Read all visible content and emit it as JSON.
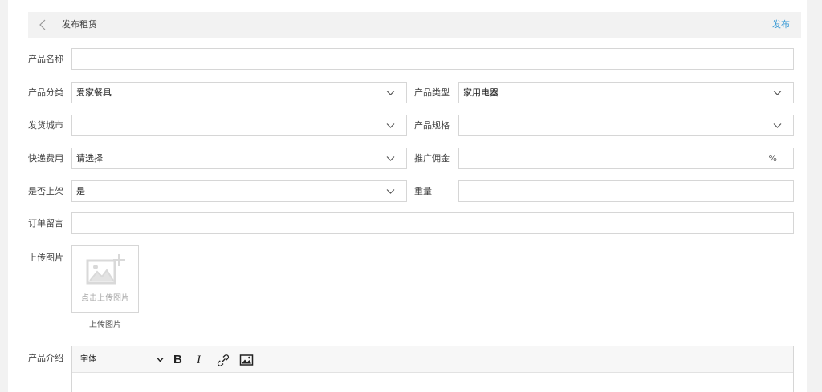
{
  "header": {
    "title": "发布租赁",
    "publish_label": "发布"
  },
  "form": {
    "product_name": {
      "label": "产品名称",
      "value": ""
    },
    "product_category": {
      "label": "产品分类",
      "value": "爱家餐具"
    },
    "product_type": {
      "label": "产品类型",
      "value": "家用电器"
    },
    "ship_city": {
      "label": "发货城市",
      "value": ""
    },
    "product_spec": {
      "label": "产品规格",
      "value": ""
    },
    "shipping_fee": {
      "label": "快递费用",
      "value": "请选择"
    },
    "promo_commission": {
      "label": "推广佣金",
      "value": "",
      "suffix": "%"
    },
    "on_shelf": {
      "label": "是否上架",
      "value": "是"
    },
    "weight": {
      "label": "重量",
      "value": ""
    },
    "order_note": {
      "label": "订单留言",
      "value": ""
    },
    "upload": {
      "label": "上传图片",
      "button_text": "点击上传图片",
      "caption": "上传图片"
    },
    "intro": {
      "label": "产品介绍",
      "font_select": "字体",
      "bold": "B",
      "italic": "I"
    }
  },
  "icons": {
    "back": "chevron-left-icon",
    "dropdown": "chevron-down-icon",
    "upload": "add-image-icon",
    "link": "link-icon",
    "image": "image-icon"
  },
  "colors": {
    "accent": "#3a9bd6",
    "header_bg": "#f2f2f2",
    "border": "#d6d6d6"
  }
}
